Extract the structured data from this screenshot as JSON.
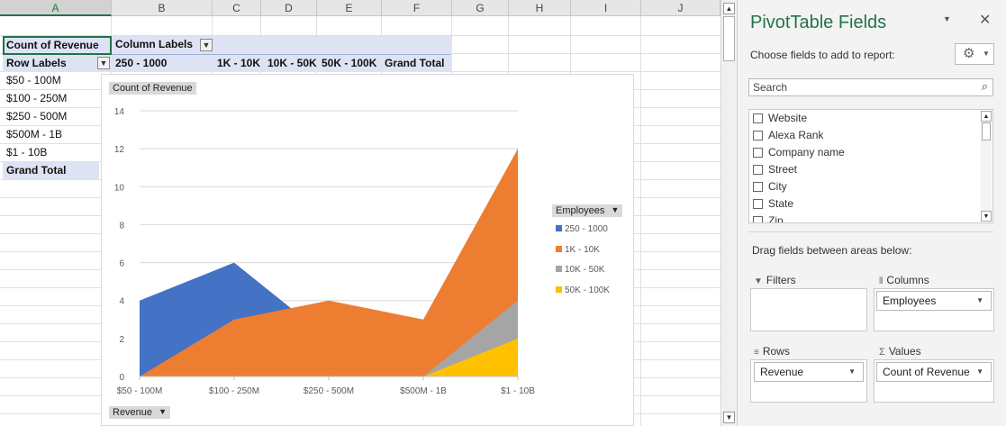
{
  "sheet": {
    "columns": [
      "A",
      "B",
      "C",
      "D",
      "E",
      "F",
      "G",
      "H",
      "I",
      "J"
    ],
    "pivot": {
      "corner_label": "Count of Revenue",
      "column_labels": "Column Labels",
      "row_labels": "Row Labels",
      "col_headers": [
        "250 - 1000",
        "1K - 10K",
        "10K - 50K",
        "50K - 100K",
        "Grand Total"
      ],
      "rows": [
        "$50 - 100M",
        "$100 - 250M",
        "$250 - 500M",
        "$500M - 1B",
        "$1 - 10B"
      ],
      "grand_total": "Grand Total"
    }
  },
  "chart": {
    "field_button": "Count of Revenue",
    "axis_field_button": "Revenue",
    "legend_title": "Employees",
    "colors": {
      "250 - 1000": "#4472c4",
      "1K - 10K": "#ed7d31",
      "10K - 50K": "#a5a5a5",
      "50K - 100K": "#ffc000"
    },
    "icons": {
      "filter": "funnel-icon",
      "dropdown": "chevron-down-icon"
    }
  },
  "chart_data": {
    "type": "area",
    "categories": [
      "$50 - 100M",
      "$100 - 250M",
      "$250 - 500M",
      "$500M - 1B",
      "$1 - 10B"
    ],
    "series": [
      {
        "name": "250 - 1000",
        "values": [
          4,
          6,
          2,
          0,
          0
        ]
      },
      {
        "name": "1K - 10K",
        "values": [
          0,
          3,
          4,
          3,
          12
        ]
      },
      {
        "name": "10K - 50K",
        "values": [
          0,
          0,
          0,
          0,
          4
        ]
      },
      {
        "name": "50K - 100K",
        "values": [
          0,
          0,
          0,
          0,
          2
        ]
      }
    ],
    "yticks": [
      0,
      2,
      4,
      6,
      8,
      10,
      12,
      14
    ],
    "ylim": [
      0,
      14
    ],
    "grid": true,
    "legend_position": "right"
  },
  "panel": {
    "title": "PivotTable Fields",
    "choose_text": "Choose fields to add to report:",
    "search_placeholder": "Search",
    "fields": [
      "Website",
      "Alexa Rank",
      "Company name",
      "Street",
      "City",
      "State",
      "Zip"
    ],
    "drag_text": "Drag fields between areas below:",
    "areas": {
      "filters": "Filters",
      "columns": "Columns",
      "rows": "Rows",
      "values": "Values"
    },
    "columns_field": "Employees",
    "rows_field": "Revenue",
    "values_field": "Count of Revenue"
  }
}
